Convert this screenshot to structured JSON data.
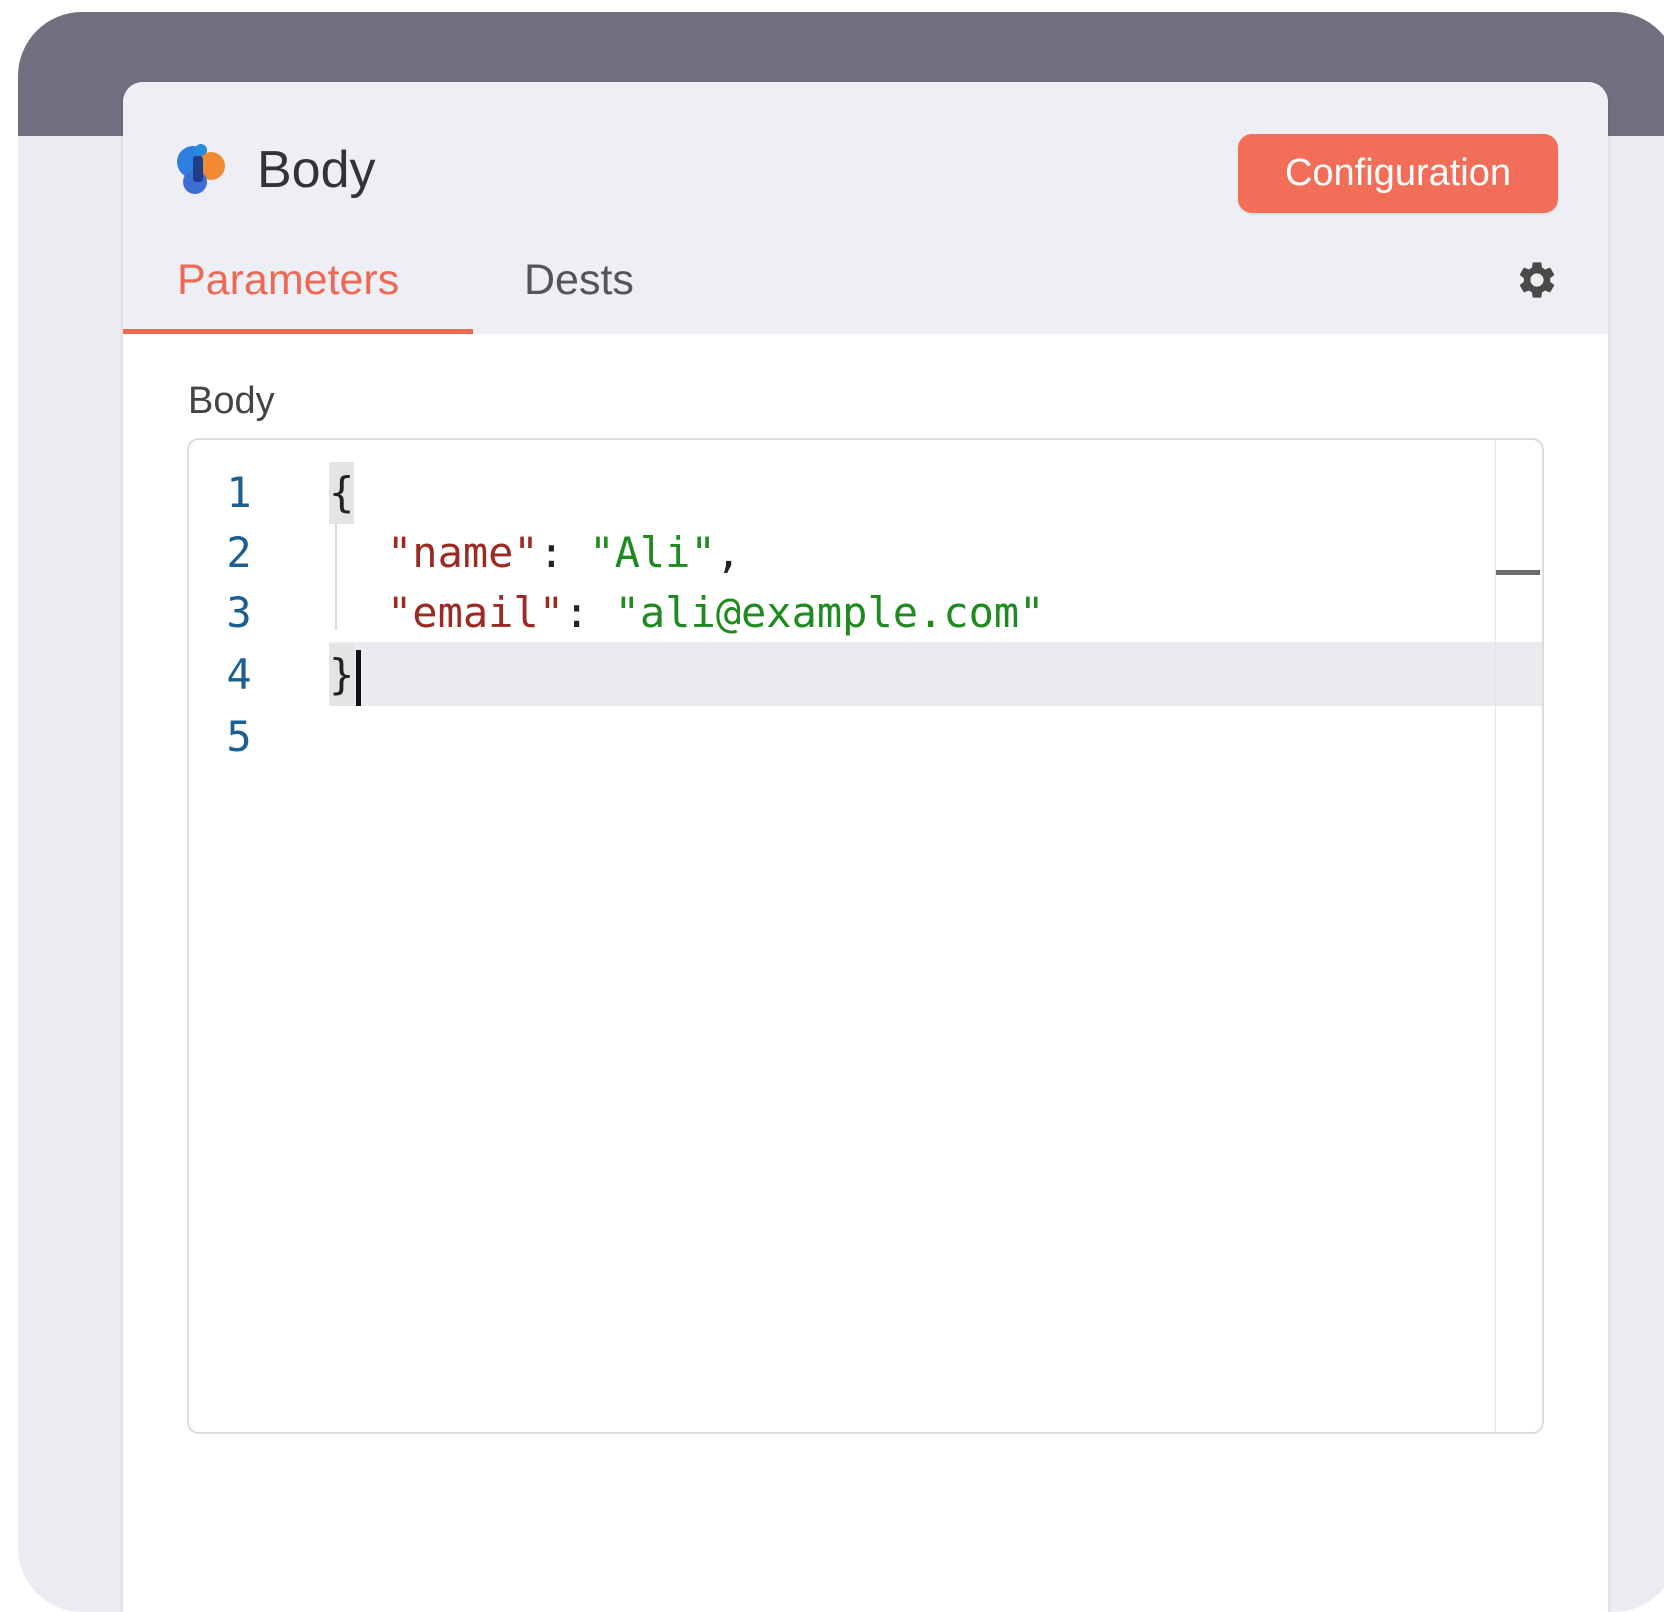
{
  "header": {
    "title": "Body",
    "config_button_label": "Configuration",
    "logo_icon": "app-logo-icon"
  },
  "tabs": [
    {
      "label": "Parameters",
      "active": true
    },
    {
      "label": "Dests",
      "active": false
    }
  ],
  "settings_icon": "gear-icon",
  "field": {
    "label": "Body"
  },
  "editor": {
    "line_numbers": [
      "1",
      "2",
      "3",
      "4",
      "5"
    ],
    "lines": [
      {
        "open": "{"
      },
      {
        "key": "\"name\"",
        "colon": ": ",
        "value": "\"Ali\"",
        "trail": ","
      },
      {
        "key": "\"email\"",
        "colon": ": ",
        "value": "\"ali@example.com\"",
        "trail": ""
      },
      {
        "close": "}"
      },
      {}
    ],
    "cursor_line": 4
  },
  "colors": {
    "accent": "#f26e58",
    "tab_active": "#ec6a55",
    "header_bar": "#716f80",
    "json_key": "#9b2a22",
    "json_string": "#1f8a1f",
    "line_number": "#1b5f92"
  }
}
